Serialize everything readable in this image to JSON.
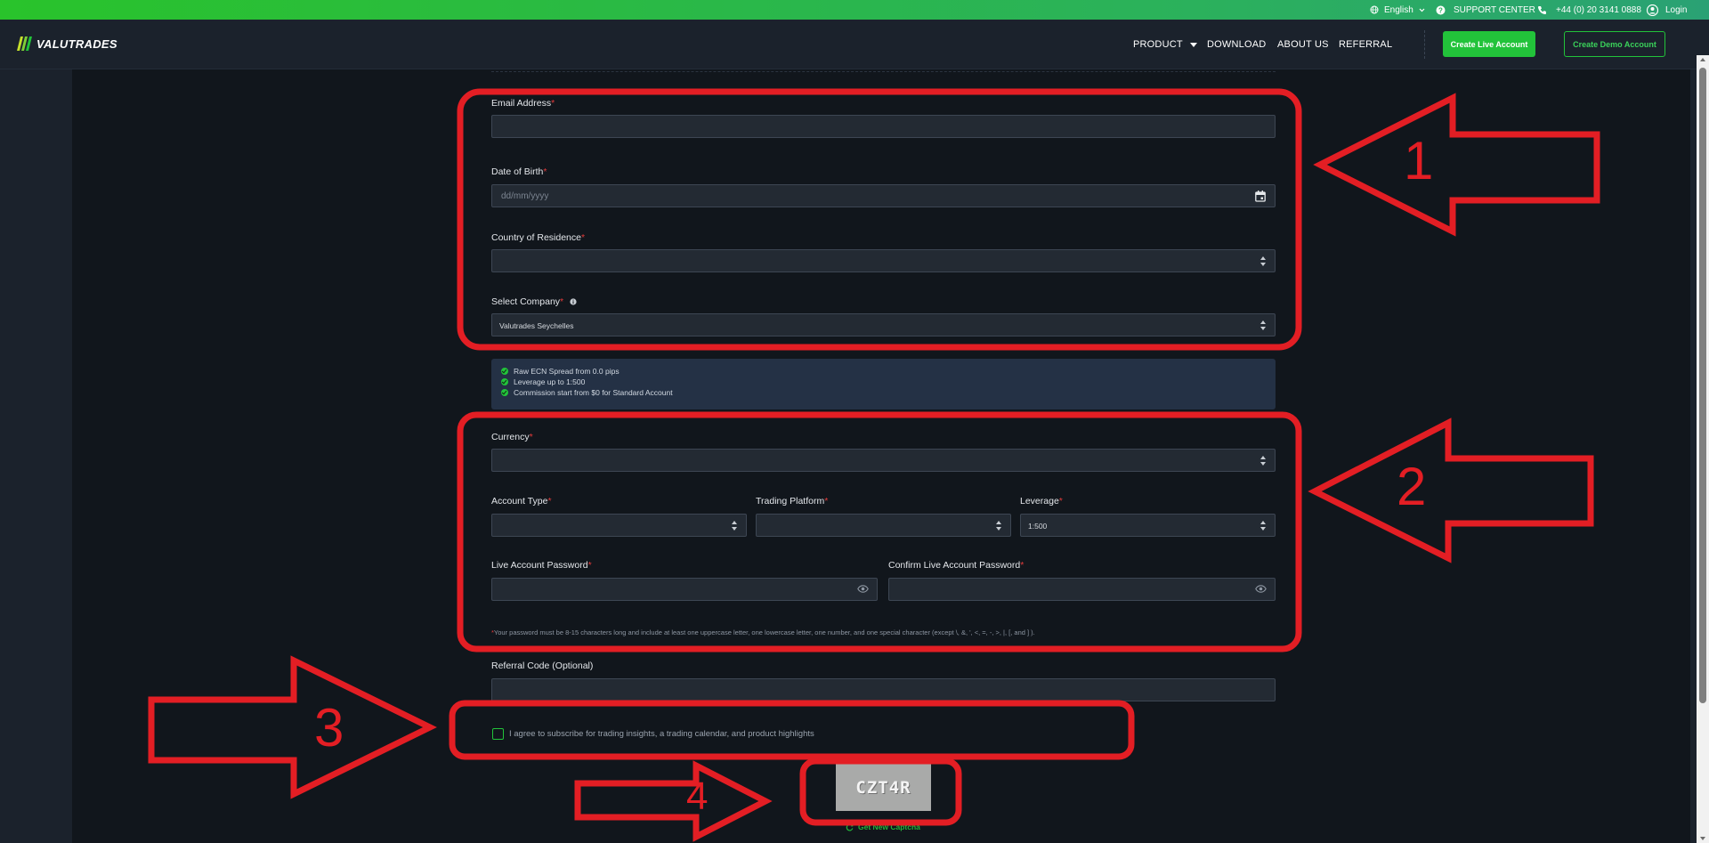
{
  "colors": {
    "accent": "#22c33a",
    "required": "#e23b3b",
    "annotation": "#e31e24",
    "panel": "#11161c",
    "field": "#232a33"
  },
  "topbar": {
    "language": "English",
    "support": "SUPPORT CENTER",
    "phone": "+44 (0) 20 3141 0888",
    "login": "Login"
  },
  "nav": {
    "logo": "VALUTRADES",
    "links": [
      "PRODUCT",
      "DOWNLOAD",
      "ABOUT US",
      "REFERRAL"
    ],
    "create_live": "Create Live Account",
    "create_demo": "Create Demo Account"
  },
  "form": {
    "req": "*",
    "email": {
      "label": "Email Address",
      "value": ""
    },
    "dob": {
      "label": "Date of Birth",
      "placeholder": "dd/mm/yyyy"
    },
    "country": {
      "label": "Country of Residence",
      "value": ""
    },
    "company": {
      "label": "Select Company",
      "value": "Valutrades Seychelles"
    },
    "features": [
      "Raw ECN Spread from 0.0 pips",
      "Leverage up to 1:500",
      "Commission start from $0 for Standard Account"
    ],
    "currency": {
      "label": "Currency",
      "value": ""
    },
    "account_type": {
      "label": "Account Type",
      "value": ""
    },
    "platform": {
      "label": "Trading Platform",
      "value": ""
    },
    "leverage": {
      "label": "Leverage",
      "value": "1:500"
    },
    "password": {
      "label": "Live Account Password"
    },
    "confirm_password": {
      "label": "Confirm Live Account Password"
    },
    "password_note": "Your password must be 8-15 characters long and include at least one uppercase letter, one lowercase letter, one number, and one special character (except \\, &, ', <, =, -, >, |, [, and ] ).",
    "referral": {
      "label": "Referral Code (Optional)",
      "value": ""
    },
    "agree": {
      "checked": false,
      "text": "I agree to subscribe for trading insights, a trading calendar, and product highlights"
    },
    "captcha": {
      "code": "CZT4R",
      "refresh": "Get New Captcha"
    }
  },
  "annotations": [
    "1",
    "2",
    "3",
    "4"
  ]
}
